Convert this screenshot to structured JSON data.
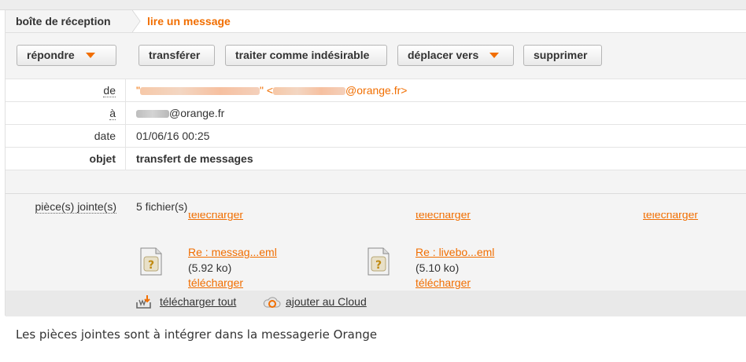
{
  "breadcrumb": {
    "home": "boîte de réception",
    "current": "lire un message"
  },
  "toolbar": {
    "reply": "répondre",
    "forward": "transférer",
    "spam": "traiter comme indésirable",
    "move": "déplacer vers",
    "delete": "supprimer"
  },
  "header": {
    "from_label": "de",
    "from_quote_open": "\"",
    "from_quote_close": "\" <",
    "from_domain": "@orange.fr>",
    "to_label": "à",
    "to_domain": "@orange.fr",
    "date_label": "date",
    "date_value": "01/06/16 00:25",
    "subject_label": "objet",
    "subject_value": "transfert de messages"
  },
  "attachments": {
    "label": "pièce(s) jointe(s)",
    "count": "5 fichier(s)",
    "download_label": "télécharger",
    "files": [
      {
        "name": "Re : messag...eml",
        "size": "(5.92 ko)",
        "download": "télécharger"
      },
      {
        "name": "Re : livebo...eml",
        "size": "(5.10 ko)",
        "download": "télécharger"
      }
    ],
    "download_all": "télécharger tout",
    "add_cloud": "ajouter au Cloud"
  },
  "body": {
    "text": "Les pièces jointes sont à intégrer dans la messagerie Orange"
  },
  "colors": {
    "accent": "#f16e00",
    "panel": "#f4f4f4"
  }
}
